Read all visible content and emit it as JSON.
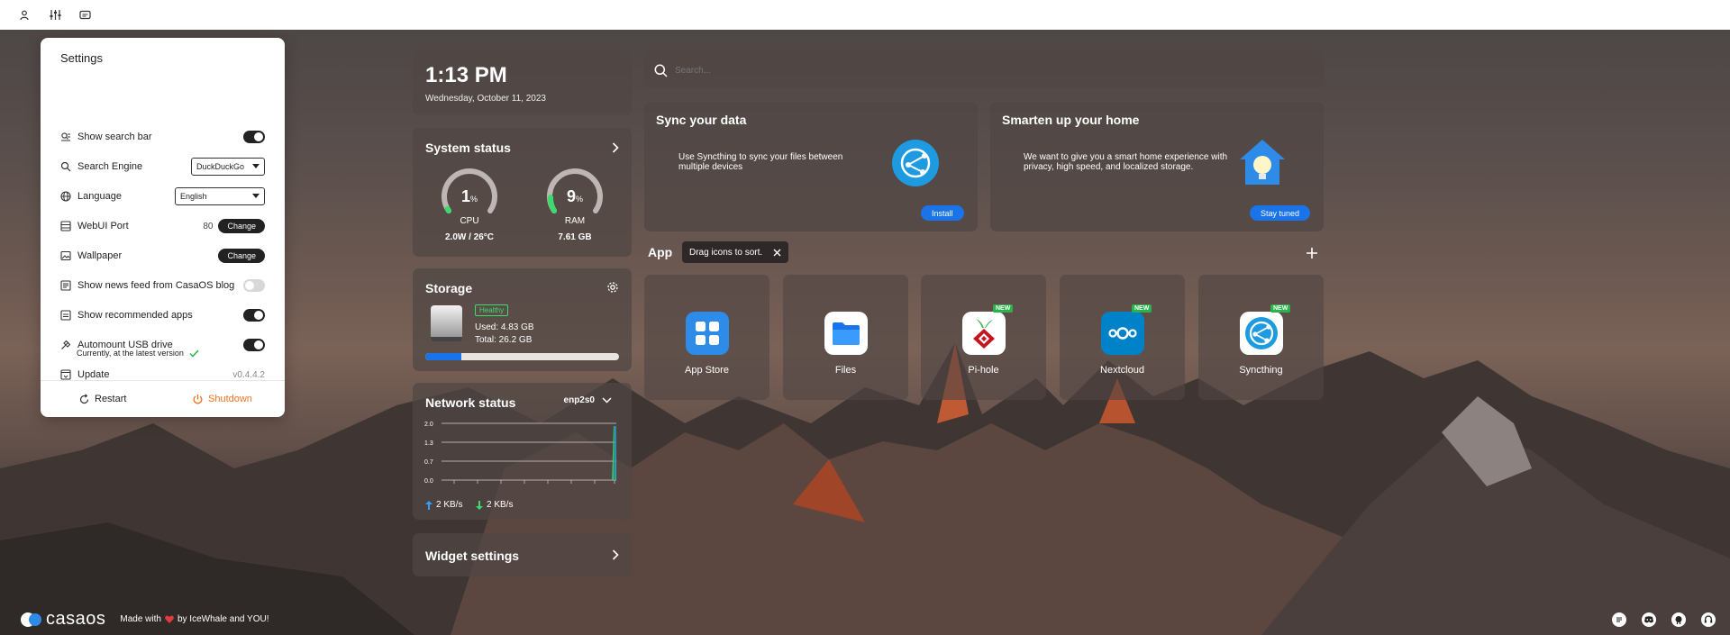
{
  "settings": {
    "title": "Settings",
    "show_search_bar": "Show search bar",
    "search_engine_label": "Search Engine",
    "search_engine_value": "DuckDuckGo",
    "language_label": "Language",
    "language_value": "English",
    "webui_port_label": "WebUI Port",
    "webui_port_value": "80",
    "change_label": "Change",
    "wallpaper_label": "Wallpaper",
    "news_feed_label": "Show news feed from CasaOS blog",
    "recommended_apps_label": "Show recommended apps",
    "automount_label": "Automount USB drive",
    "update_label": "Update",
    "update_version": "v0.4.4.2",
    "update_status": "Currently, at the latest version",
    "restart_label": "Restart",
    "shutdown_label": "Shutdown"
  },
  "clock": {
    "time": "1:13 PM",
    "date": "Wednesday, October 11, 2023"
  },
  "system_status": {
    "title": "System status",
    "cpu_value": "1",
    "cpu_unit": "%",
    "cpu_label": "CPU",
    "cpu_sub": "2.0W / 26°C",
    "ram_value": "9",
    "ram_unit": "%",
    "ram_label": "RAM",
    "ram_sub": "7.61 GB"
  },
  "storage": {
    "title": "Storage",
    "health": "Healthy",
    "used": "Used: 4.83 GB",
    "total": "Total: 26.2 GB",
    "used_fraction": 0.184
  },
  "network": {
    "title": "Network status",
    "interface": "enp2s0",
    "y_ticks": [
      "2.0",
      "1.3",
      "0.7",
      "0.0"
    ],
    "upload": "2 KB/s",
    "download": "2 KB/s"
  },
  "widget_settings": {
    "title": "Widget settings"
  },
  "search": {
    "placeholder": "Search..."
  },
  "promo_sync": {
    "title": "Sync your data",
    "text": "Use Syncthing to sync your files between multiple devices",
    "button": "Install"
  },
  "promo_home": {
    "title": "Smarten up your home",
    "text": "We want to give you a smart home experience with privacy, high speed, and localized storage.",
    "button": "Stay tuned"
  },
  "app_section": {
    "title": "App",
    "tooltip": "Drag icons to sort."
  },
  "apps": [
    {
      "name": "App Store",
      "new": ""
    },
    {
      "name": "Files",
      "new": ""
    },
    {
      "name": "Pi-hole",
      "new": "NEW"
    },
    {
      "name": "Nextcloud",
      "new": "NEW"
    },
    {
      "name": "Syncthing",
      "new": "NEW"
    }
  ],
  "footer": {
    "logo": "casaos",
    "made_with": "Made with",
    "by": "by IceWhale and YOU!"
  },
  "colors": {
    "accent": "#1a73e8",
    "shutdown": "#f0731f",
    "new_badge": "#2bb34b"
  }
}
